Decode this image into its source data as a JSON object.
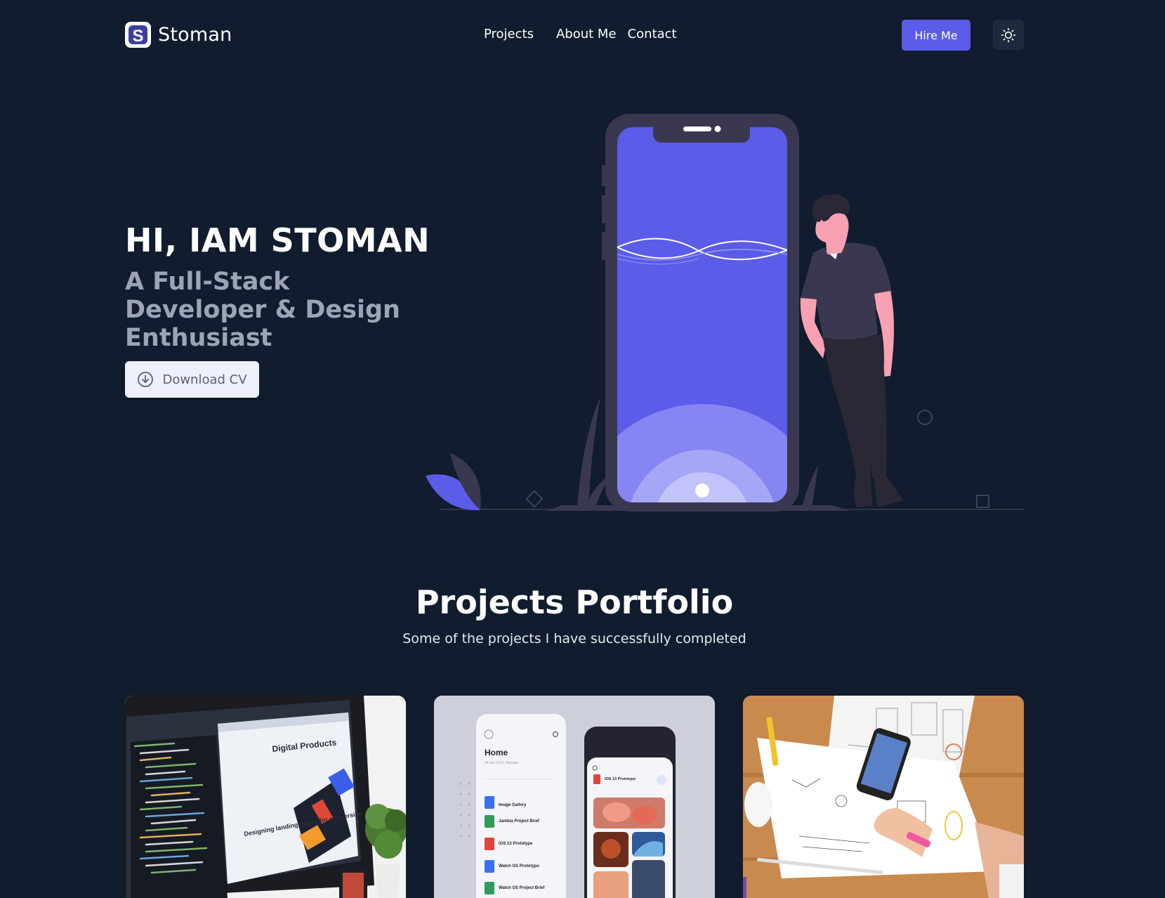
{
  "nav": {
    "logo_letter": "S",
    "brand": "Stoman",
    "links": [
      "Projects",
      "About Me",
      "Contact"
    ],
    "hire_label": "Hire Me",
    "theme_icon": "sun-icon"
  },
  "hero": {
    "title": "HI, IAM STOMAN",
    "subtitle": "A Full-Stack Developer & Design Enthusiast",
    "cv_label": "Download CV",
    "cv_icon": "download-circle-icon"
  },
  "projects": {
    "title": "Projects Portfolio",
    "subtitle": "Some of the projects I have successfully completed",
    "cards": [
      {
        "screen_heading": "Digital Products",
        "screen_caption": "Designing landing pages for conversion"
      },
      {
        "screen_heading": "Home",
        "screen_date": "24 Jun 2019, Monday",
        "files": [
          "Image Gallery",
          "Jambia Project Brief",
          "iOS 13 Prototype",
          "Watch OS Prototype",
          "Watch OS Project Brief"
        ],
        "phone_header": "iOS 13 Prototype"
      },
      {}
    ]
  },
  "colors": {
    "background": "#111d2e",
    "accent": "#5b5ce8",
    "muted_text": "#9da5b4"
  }
}
